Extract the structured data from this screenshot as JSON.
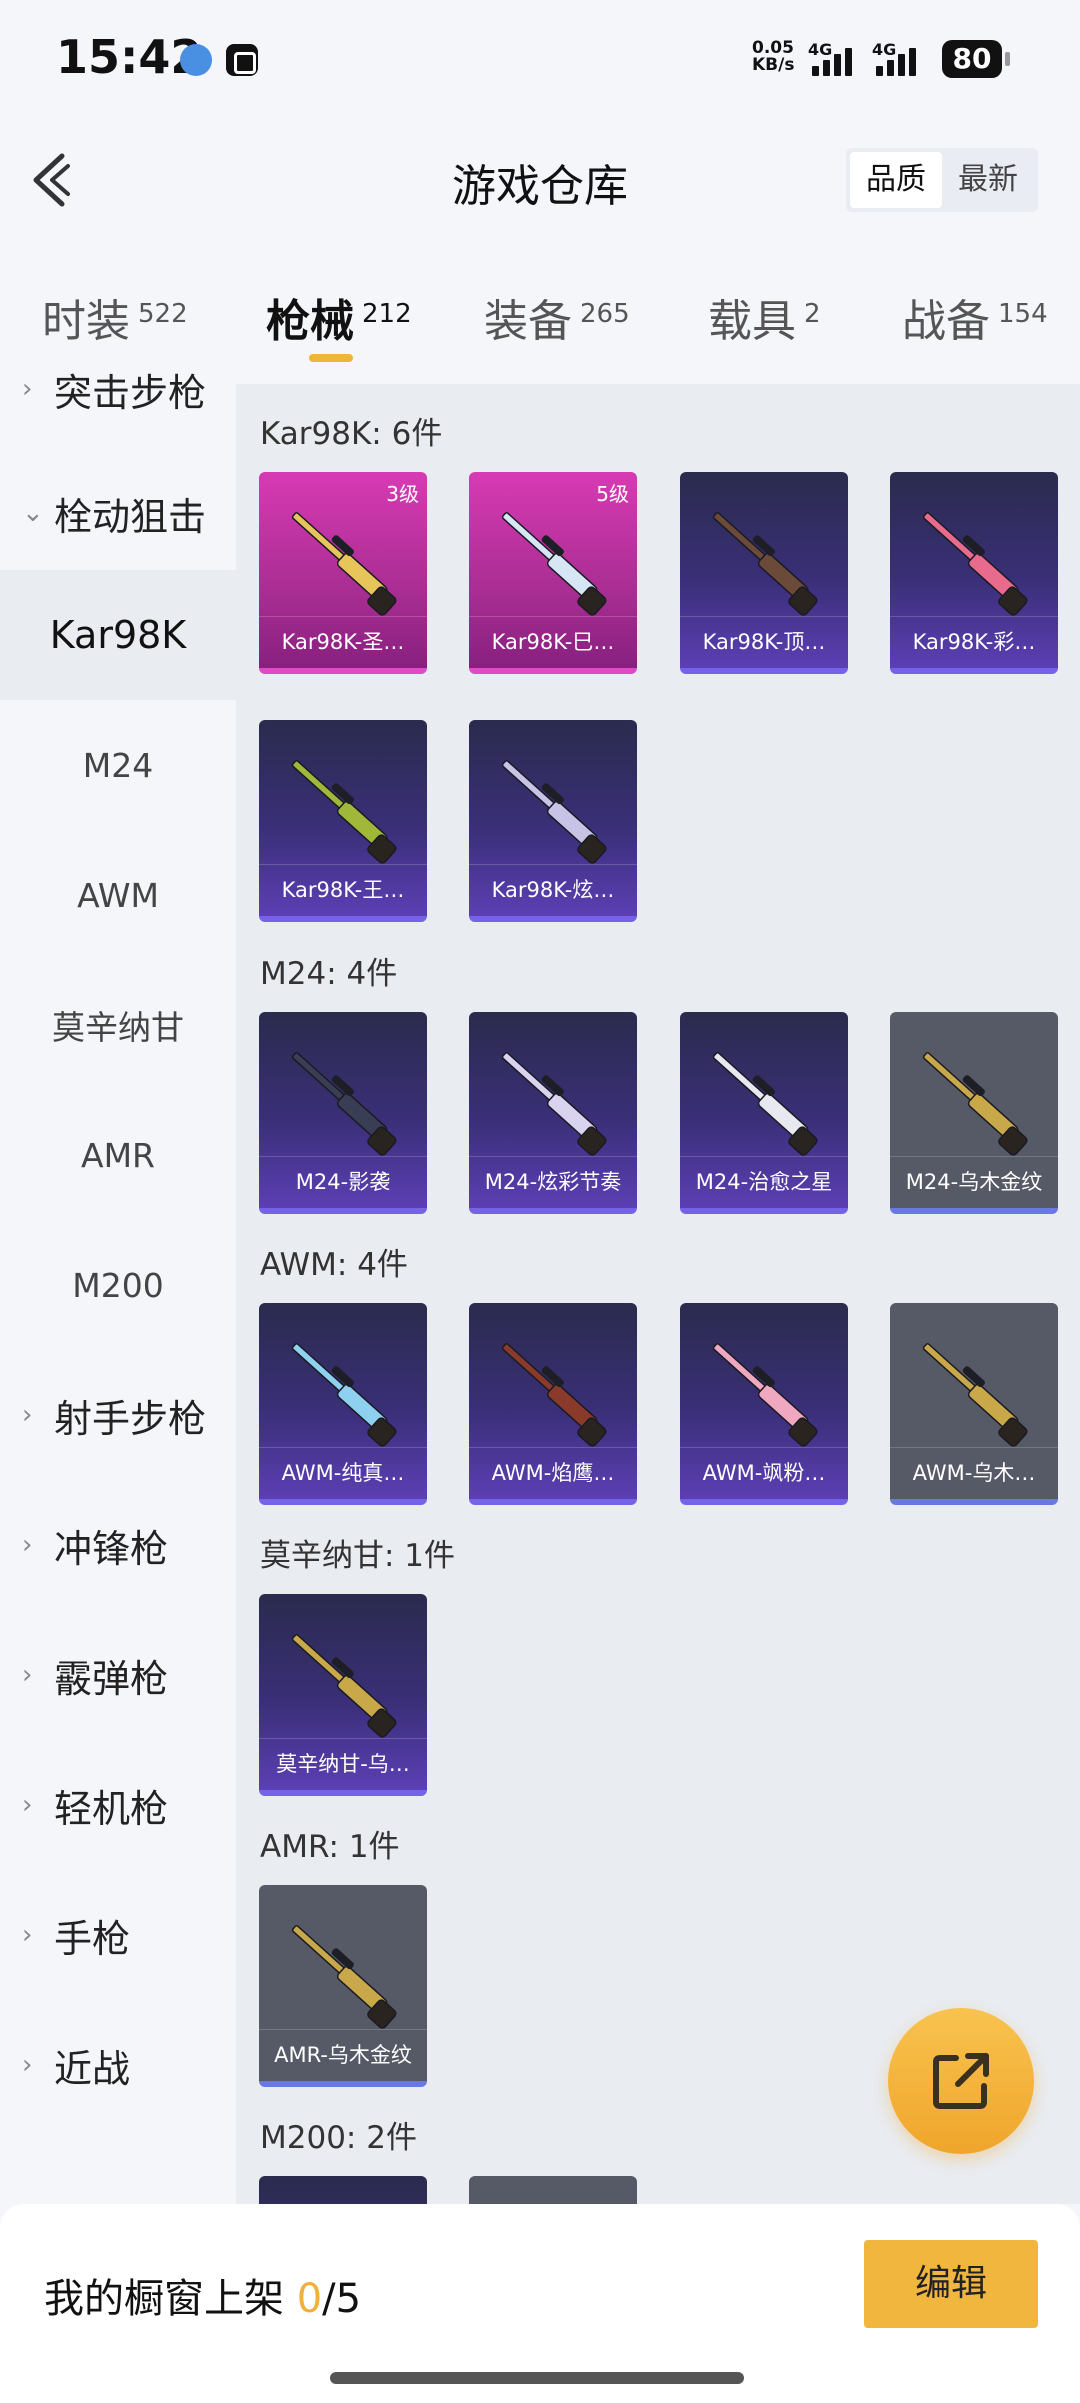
{
  "status_bar": {
    "time": "15:42",
    "net_speed_top": "0.05",
    "net_speed_bottom": "KB/s",
    "signal1": "4G",
    "signal2": "4G",
    "battery": "80"
  },
  "header": {
    "title": "游戏仓库",
    "sort_quality": "品质",
    "sort_latest": "最新"
  },
  "tabs": [
    {
      "label": "时装",
      "count": "522"
    },
    {
      "label": "枪械",
      "count": "212"
    },
    {
      "label": "装备",
      "count": "265"
    },
    {
      "label": "载具",
      "count": "2"
    },
    {
      "label": "战备",
      "count": "154"
    }
  ],
  "sidebar": [
    {
      "label": "突击步枪",
      "type": "group",
      "chevron": "›"
    },
    {
      "label": "栓动狙击",
      "type": "group",
      "chevron": "⌄"
    },
    {
      "label": "Kar98K",
      "type": "sub"
    },
    {
      "label": "M24",
      "type": "sub"
    },
    {
      "label": "AWM",
      "type": "sub"
    },
    {
      "label": "莫辛纳甘",
      "type": "sub"
    },
    {
      "label": "AMR",
      "type": "sub"
    },
    {
      "label": "M200",
      "type": "sub"
    },
    {
      "label": "射手步枪",
      "type": "group",
      "chevron": "›"
    },
    {
      "label": "冲锋枪",
      "type": "group",
      "chevron": "›"
    },
    {
      "label": "霰弹枪",
      "type": "group",
      "chevron": "›"
    },
    {
      "label": "轻机枪",
      "type": "group",
      "chevron": "›"
    },
    {
      "label": "手枪",
      "type": "group",
      "chevron": "›"
    },
    {
      "label": "近战",
      "type": "group",
      "chevron": "›"
    }
  ],
  "sections": [
    {
      "title": "Kar98K: 6件",
      "items": [
        {
          "name": "Kar98K-圣…",
          "level": "3级",
          "quality": "pink",
          "gun_color": "#e8c55a"
        },
        {
          "name": "Kar98K-巳…",
          "level": "5级",
          "quality": "pink",
          "gun_color": "#d7e6f5"
        },
        {
          "name": "Kar98K-顶…",
          "level": "",
          "quality": "purple",
          "gun_color": "#6b4a3a"
        },
        {
          "name": "Kar98K-彩…",
          "level": "",
          "quality": "purple",
          "gun_color": "#e86a8c"
        },
        {
          "name": "Kar98K-王…",
          "level": "",
          "quality": "purple",
          "gun_color": "#9fb83a"
        },
        {
          "name": "Kar98K-炫…",
          "level": "",
          "quality": "purple",
          "gun_color": "#c7c3e6"
        }
      ]
    },
    {
      "title": "M24: 4件",
      "items": [
        {
          "name": "M24-影袭",
          "level": "",
          "quality": "purple",
          "gun_color": "#3a3e55"
        },
        {
          "name": "M24-炫彩节奏",
          "level": "",
          "quality": "purple",
          "gun_color": "#d9d3f0"
        },
        {
          "name": "M24-治愈之星",
          "level": "",
          "quality": "purple",
          "gun_color": "#e8e8f0"
        },
        {
          "name": "M24-乌木金纹",
          "level": "",
          "quality": "gray",
          "gun_color": "#c9a84a"
        }
      ]
    },
    {
      "title": "AWM: 4件",
      "items": [
        {
          "name": "AWM-纯真…",
          "level": "",
          "quality": "purple",
          "gun_color": "#8ed0f0"
        },
        {
          "name": "AWM-焰鹰…",
          "level": "",
          "quality": "purple",
          "gun_color": "#8a3a2a"
        },
        {
          "name": "AWM-飒粉…",
          "level": "",
          "quality": "purple",
          "gun_color": "#f0a8c0"
        },
        {
          "name": "AWM-乌木…",
          "level": "",
          "quality": "gray",
          "gun_color": "#c9a84a"
        }
      ]
    },
    {
      "title": "莫辛纳甘: 1件",
      "items": [
        {
          "name": "莫辛纳甘-乌…",
          "level": "",
          "quality": "purple",
          "gun_color": "#c9a84a"
        }
      ]
    },
    {
      "title": "AMR: 1件",
      "items": [
        {
          "name": "AMR-乌木金纹",
          "level": "",
          "quality": "gray",
          "gun_color": "#c9a84a"
        }
      ]
    },
    {
      "title": "M200: 2件",
      "items": [
        {
          "name": "",
          "level": "",
          "quality": "purple",
          "gun_color": "#3a3e55"
        },
        {
          "name": "",
          "level": "",
          "quality": "gray",
          "gun_color": "#c9a84a"
        }
      ]
    }
  ],
  "bottom": {
    "label": "我的橱窗上架",
    "current": "0",
    "total": "/5",
    "edit_label": "编辑"
  },
  "colors": {
    "accent": "#f0b63e",
    "pink_quality": "#d83ab3",
    "purple_quality": "#5c3fb4",
    "gray_quality": "#565a66"
  }
}
